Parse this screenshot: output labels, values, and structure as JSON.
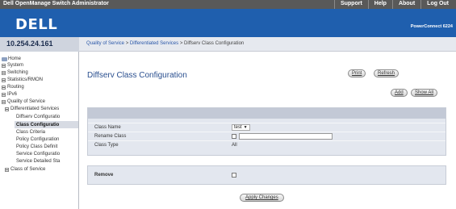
{
  "topbar": {
    "title": "Dell OpenManage Switch Administrator",
    "links": [
      "Support",
      "Help",
      "About",
      "Log Out"
    ]
  },
  "brand": {
    "logo": "DELL",
    "model": "PowerConnect 6224"
  },
  "ip": "10.254.24.161",
  "breadcrumb": {
    "parts": [
      "Quality of Service",
      "Differentiated Services",
      "Diffserv Class Configuration"
    ],
    "separator": ">"
  },
  "sidebar": {
    "items": [
      {
        "label": "Home",
        "level": 0
      },
      {
        "label": "System",
        "level": 0
      },
      {
        "label": "Switching",
        "level": 0
      },
      {
        "label": "Statistics/RMON",
        "level": 0
      },
      {
        "label": "Routing",
        "level": 0
      },
      {
        "label": "IPv6",
        "level": 0
      },
      {
        "label": "Quality of Service",
        "level": 0
      },
      {
        "label": "Differentiated Services",
        "level": 1
      },
      {
        "label": "Diffserv Configuratio",
        "level": 2
      },
      {
        "label": "Class Configuratio",
        "level": 2,
        "selected": true
      },
      {
        "label": "Class Criteria",
        "level": 2
      },
      {
        "label": "Policy Configuration",
        "level": 2
      },
      {
        "label": "Policy Class Definit",
        "level": 2
      },
      {
        "label": "Service Configuratio",
        "level": 2
      },
      {
        "label": "Service Detailed Sta",
        "level": 2
      },
      {
        "label": "Class of Service",
        "level": 1
      }
    ]
  },
  "main": {
    "title": "Diffserv Class Configuration",
    "buttons": {
      "print": "Print",
      "refresh": "Refresh",
      "add": "Add",
      "show_all": "Show All",
      "apply": "Apply Changes"
    },
    "form": {
      "class_name_label": "Class Name",
      "class_name_value": "test",
      "rename_label": "Rename Class",
      "rename_value": "",
      "class_type_label": "Class Type",
      "class_type_value": "All",
      "remove_label": "Remove"
    }
  },
  "colors": {
    "brand_blue": "#1f5fae",
    "topbar_gray": "#595959",
    "title_blue": "#2a4f8f",
    "panel_bg": "#e3e7ef"
  }
}
